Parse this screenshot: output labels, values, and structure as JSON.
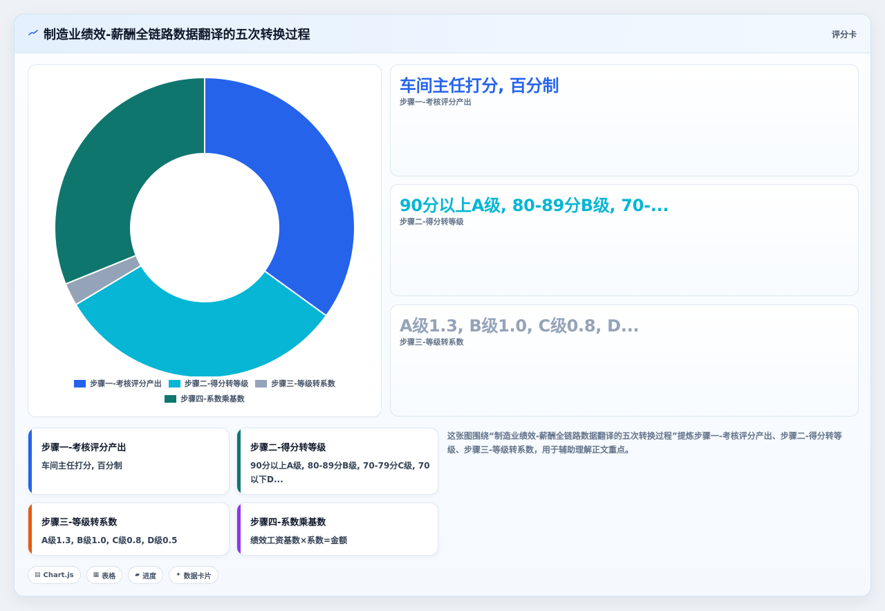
{
  "header": {
    "title": "制造业绩效-薪酬全链路数据翻译的五次转换过程",
    "tag": "评分卡"
  },
  "colors": {
    "blue": "#2563eb",
    "cyan": "#06b6d4",
    "gray": "#94a3b8",
    "teal": "#0f766e",
    "orange": "#ea580c",
    "purple": "#9333ea"
  },
  "chart_data": {
    "type": "pie",
    "donut": true,
    "categories": [
      "步骤一-考核评分产出",
      "步骤二-得分转等级",
      "步骤三-等级转系数",
      "步骤四-系数乘基数"
    ],
    "values": [
      100,
      90,
      7,
      89
    ],
    "colors": [
      "#2563eb",
      "#06b6d4",
      "#94a3b8",
      "#0f766e"
    ],
    "legend": "bottom"
  },
  "kpis": [
    {
      "value": "车间主任打分, 百分制",
      "label": "步骤一-考核评分产出",
      "color": "#2563eb"
    },
    {
      "value": "90分以上A级, 80-89分B级, 70-...",
      "label": "步骤二-得分转等级",
      "color": "#06b6d4"
    },
    {
      "value": "A级1.3, B级1.0, C级0.8, D...",
      "label": "步骤三-等级转系数",
      "color": "#94a3b8"
    }
  ],
  "steps": [
    {
      "title": "步骤一-考核评分产出",
      "desc": "车间主任打分, 百分制",
      "color": "#2563eb"
    },
    {
      "title": "步骤二-得分转等级",
      "desc": "90分以上A级, 80-89分B级, 70-79分C级, 70以下D...",
      "color": "#0f766e"
    },
    {
      "title": "步骤三-等级转系数",
      "desc": "A级1.3, B级1.0, C级0.8, D级0.5",
      "color": "#ea580c"
    },
    {
      "title": "步骤四-系数乘基数",
      "desc": "绩效工资基数×系数=金额",
      "color": "#9333ea"
    }
  ],
  "summary": "这张图围绕“制造业绩效-薪酬全链路数据翻译的五次转换过程”提炼步骤一-考核评分产出、步骤二-得分转等级、步骤三-等级转系数，用于辅助理解正文重点。",
  "chips": [
    {
      "icon": "▤",
      "label": "Chart.js",
      "icon_name": "chart-icon"
    },
    {
      "icon": "▦",
      "label": "表格",
      "icon_name": "table-icon"
    },
    {
      "icon": "▰",
      "label": "进度",
      "icon_name": "progress-icon"
    },
    {
      "icon": "✦",
      "label": "数据卡片",
      "icon_name": "sparkle-icon"
    }
  ]
}
